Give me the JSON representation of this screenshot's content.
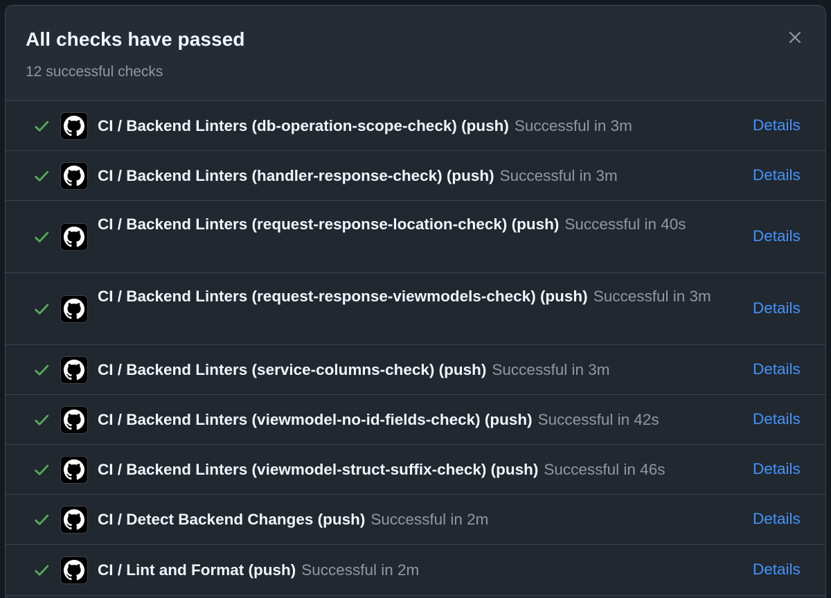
{
  "dialog": {
    "title": "All checks have passed",
    "subtitle": "12 successful checks",
    "close_icon": "close-icon"
  },
  "colors": {
    "success": "#57ab5a",
    "link": "#4493f8",
    "muted": "#9198a1",
    "text": "#f0f6fc"
  },
  "checks": [
    {
      "name": "CI / Backend Linters (db-operation-scope-check) (push)",
      "status": "Successful in 3m",
      "details_label": "Details",
      "status_icon": "check-icon",
      "avatar_icon": "github-icon"
    },
    {
      "name": "CI / Backend Linters (handler-response-check) (push)",
      "status": "Successful in 3m",
      "details_label": "Details",
      "status_icon": "check-icon",
      "avatar_icon": "github-icon"
    },
    {
      "name": "CI / Backend Linters (request-response-location-check) (push)",
      "status": "Successful in 40s",
      "details_label": "Details",
      "status_icon": "check-icon",
      "avatar_icon": "github-icon"
    },
    {
      "name": "CI / Backend Linters (request-response-viewmodels-check) (push)",
      "status": "Successful in 3m",
      "details_label": "Details",
      "status_icon": "check-icon",
      "avatar_icon": "github-icon"
    },
    {
      "name": "CI / Backend Linters (service-columns-check) (push)",
      "status": "Successful in 3m",
      "details_label": "Details",
      "status_icon": "check-icon",
      "avatar_icon": "github-icon"
    },
    {
      "name": "CI / Backend Linters (viewmodel-no-id-fields-check) (push)",
      "status": "Successful in 42s",
      "details_label": "Details",
      "status_icon": "check-icon",
      "avatar_icon": "github-icon"
    },
    {
      "name": "CI / Backend Linters (viewmodel-struct-suffix-check) (push)",
      "status": "Successful in 46s",
      "details_label": "Details",
      "status_icon": "check-icon",
      "avatar_icon": "github-icon"
    },
    {
      "name": "CI / Detect Backend Changes (push)",
      "status": "Successful in 2m",
      "details_label": "Details",
      "status_icon": "check-icon",
      "avatar_icon": "github-icon"
    },
    {
      "name": "CI / Lint and Format (push)",
      "status": "Successful in 2m",
      "details_label": "Details",
      "status_icon": "check-icon",
      "avatar_icon": "github-icon"
    }
  ]
}
